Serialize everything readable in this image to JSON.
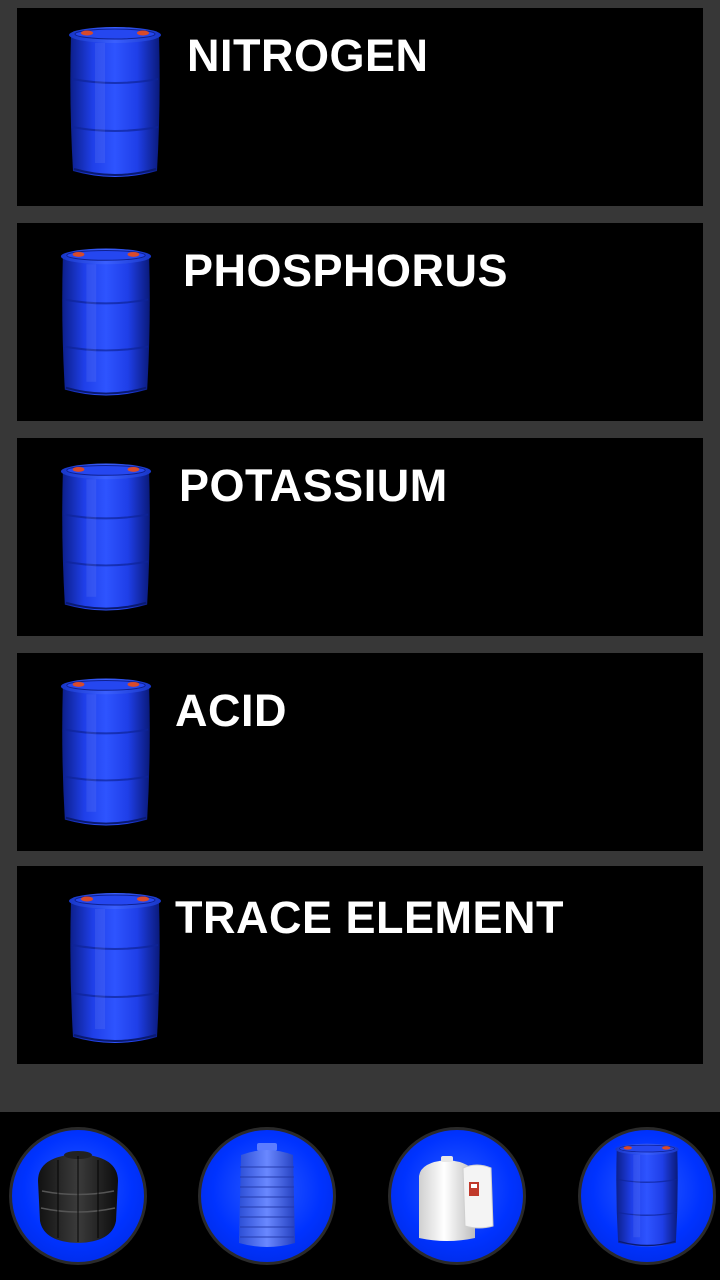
{
  "categories": [
    {
      "label": "NITROGEN"
    },
    {
      "label": "PHOSPHORUS"
    },
    {
      "label": "POTASSIUM"
    },
    {
      "label": "ACID"
    },
    {
      "label": "TRACE ELEMENT"
    }
  ],
  "bottom_nav": [
    {
      "icon": "black-septic-tank-icon"
    },
    {
      "icon": "blue-water-tank-icon"
    },
    {
      "icon": "white-chemical-tank-icon"
    },
    {
      "icon": "blue-drum-icon"
    }
  ],
  "colors": {
    "background": "#373737",
    "card": "#000000",
    "drum_blue": "#1a3be6",
    "nav_circle": "#0033ff",
    "text": "#ffffff"
  }
}
